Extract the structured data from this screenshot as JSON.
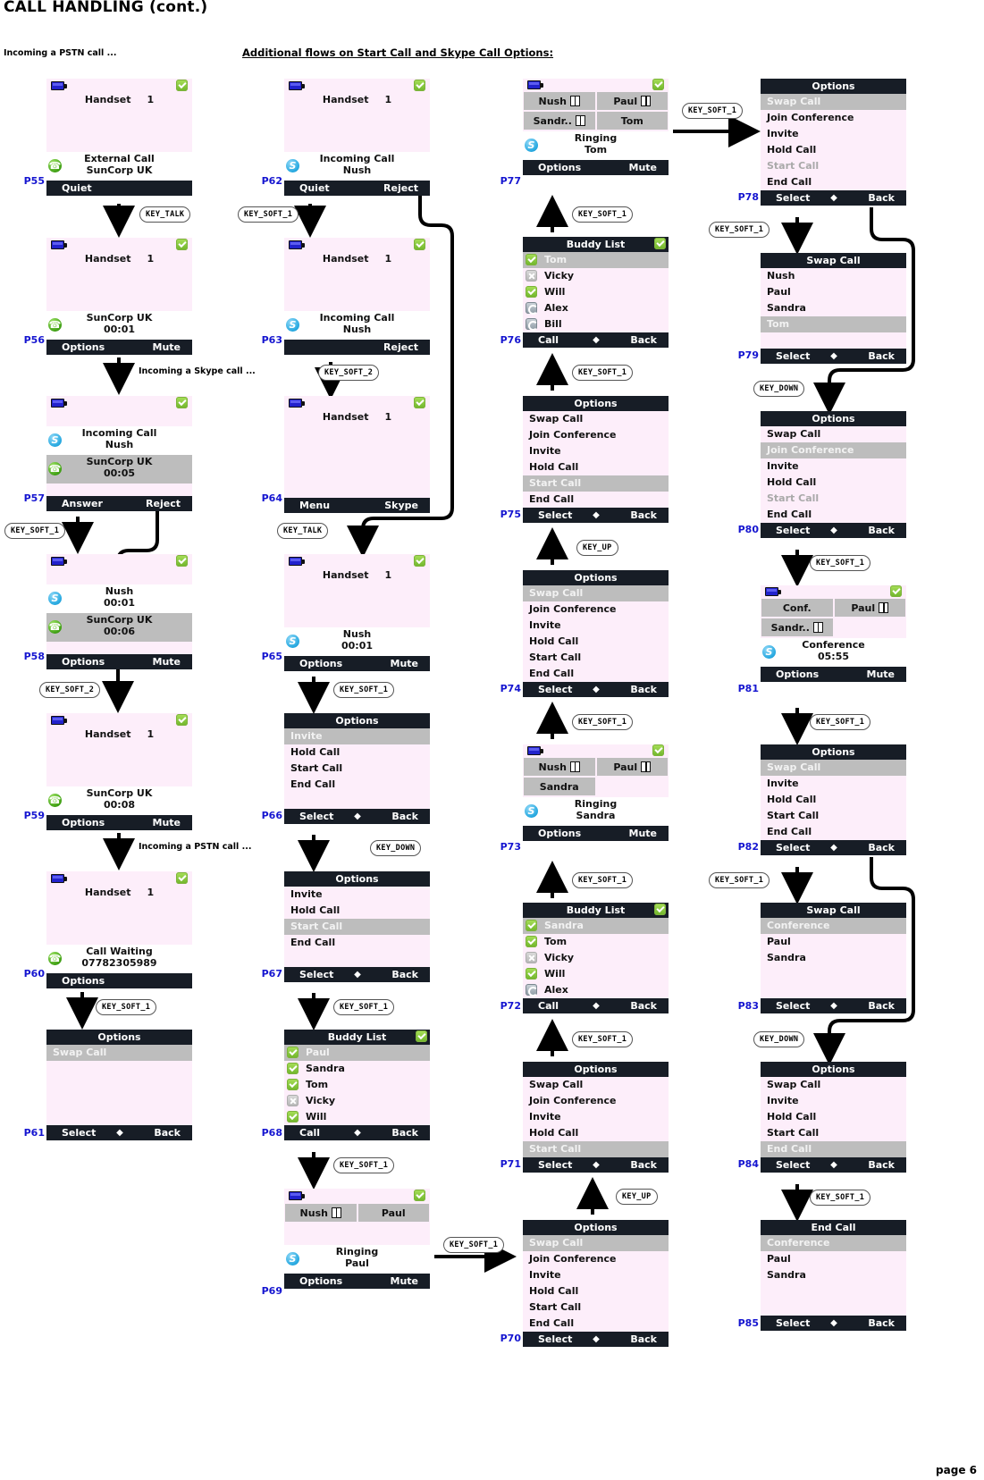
{
  "title": "CALL HANDLING (cont.)",
  "page_label": "page 6",
  "captions": {
    "pstn": "Incoming a PSTN call ...",
    "additional": "Additional flows on Start Call and Skype Call Options:",
    "skype_inline": "Incoming a Skype call ...",
    "pstn_inline": "Incoming a PSTN call ..."
  },
  "keys": {
    "talk": "KEY_TALK",
    "soft1": "KEY_SOFT_1",
    "soft2": "KEY_SOFT_2",
    "up": "KEY_UP",
    "down": "KEY_DOWN"
  },
  "screens": {
    "P55": {
      "id": "P55",
      "handset": "Handset",
      "handset_num": "1",
      "info_l1": "External Call",
      "info_l2": "SunCorp UK",
      "info_icon": "pstn-icon",
      "sk_left": "Quiet",
      "sk_right": ""
    },
    "P56": {
      "id": "P56",
      "handset": "Handset",
      "handset_num": "1",
      "info_l1": "SunCorp UK",
      "info_l2": "00:01",
      "info_icon": "pstn-icon",
      "sk_left": "Options",
      "sk_right": "Mute"
    },
    "P57": {
      "id": "P57",
      "info_l1": "Incoming Call",
      "info_l2": "Nush",
      "info_icon": "skype-icon",
      "held_l1": "SunCorp UK",
      "held_l2": "00:05",
      "held_icon": "pstn-icon",
      "sk_left": "Answer",
      "sk_right": "Reject"
    },
    "P58": {
      "id": "P58",
      "info_l1": "Nush",
      "info_l2": "00:01",
      "info_icon": "skype-icon",
      "held_l1": "SunCorp UK",
      "held_l2": "00:06",
      "held_icon": "pstn-icon",
      "sk_left": "Options",
      "sk_right": "Mute"
    },
    "P59": {
      "id": "P59",
      "handset": "Handset",
      "handset_num": "1",
      "info_l1": "SunCorp UK",
      "info_l2": "00:08",
      "info_icon": "pstn-icon",
      "sk_left": "Options",
      "sk_right": "Mute"
    },
    "P60": {
      "id": "P60",
      "handset": "Handset",
      "handset_num": "1",
      "info_l1": "Call Waiting",
      "info_l2": "07782305989",
      "info_icon": "pstn-icon",
      "sk_left": "Options",
      "sk_right": ""
    },
    "P61": {
      "id": "P61",
      "title": "Options",
      "items": [
        {
          "label": "Swap Call",
          "state": "selected"
        }
      ],
      "sk_left": "Select",
      "sk_right": "Back"
    },
    "P62": {
      "id": "P62",
      "handset": "Handset",
      "handset_num": "1",
      "info_l1": "Incoming Call",
      "info_l2": "Nush",
      "info_icon": "skype-icon",
      "sk_left": "Quiet",
      "sk_right": "Reject"
    },
    "P63": {
      "id": "P63",
      "handset": "Handset",
      "handset_num": "1",
      "info_l1": "Incoming Call",
      "info_l2": "Nush",
      "info_icon": "skype-icon",
      "sk_left": "",
      "sk_right": "Reject"
    },
    "P64": {
      "id": "P64",
      "handset": "Handset",
      "handset_num": "1",
      "sk_left": "Menu",
      "sk_right": "Skype"
    },
    "P65": {
      "id": "P65",
      "handset": "Handset",
      "handset_num": "1",
      "info_l1": "Nush",
      "info_l2": "00:01",
      "info_icon": "skype-icon",
      "sk_left": "Options",
      "sk_right": "Mute"
    },
    "P66": {
      "id": "P66",
      "title": "Options",
      "items": [
        {
          "label": "Invite",
          "state": "selected"
        },
        {
          "label": "Hold Call",
          "state": "normal"
        },
        {
          "label": "Start Call",
          "state": "normal"
        },
        {
          "label": "End Call",
          "state": "normal"
        }
      ],
      "sk_left": "Select",
      "sk_right": "Back"
    },
    "P67": {
      "id": "P67",
      "title": "Options",
      "items": [
        {
          "label": "Invite",
          "state": "normal"
        },
        {
          "label": "Hold Call",
          "state": "normal"
        },
        {
          "label": "Start Call",
          "state": "selected"
        },
        {
          "label": "End Call",
          "state": "normal"
        }
      ],
      "sk_left": "Select",
      "sk_right": "Back"
    },
    "P68": {
      "id": "P68",
      "title": "Buddy List",
      "title_badge": "ok-badge",
      "buddies": [
        {
          "name": "Paul",
          "status": "online",
          "state": "selected"
        },
        {
          "name": "Sandra",
          "status": "online",
          "state": "normal"
        },
        {
          "name": "Tom",
          "status": "online",
          "state": "normal"
        },
        {
          "name": "Vicky",
          "status": "offline",
          "state": "normal"
        },
        {
          "name": "Will",
          "status": "online",
          "state": "normal"
        }
      ],
      "sk_left": "Call",
      "sk_right": "Back"
    },
    "P69": {
      "id": "P69",
      "lines": [
        [
          "Nush",
          "Paul"
        ]
      ],
      "lines_hold": [
        [
          true,
          false
        ]
      ],
      "info_l1": "Ringing",
      "info_l2": "Paul",
      "info_icon": "skype-icon",
      "sk_left": "Options",
      "sk_right": "Mute"
    },
    "P70": {
      "id": "P70",
      "title": "Options",
      "items": [
        {
          "label": "Swap Call",
          "state": "selected"
        },
        {
          "label": "Join Conference",
          "state": "normal"
        },
        {
          "label": "Invite",
          "state": "normal"
        },
        {
          "label": "Hold Call",
          "state": "normal"
        },
        {
          "label": "Start Call",
          "state": "normal"
        },
        {
          "label": "End Call",
          "state": "normal"
        }
      ],
      "sk_left": "Select",
      "sk_right": "Back"
    },
    "P71": {
      "id": "P71",
      "title": "Options",
      "items": [
        {
          "label": "Swap Call",
          "state": "normal"
        },
        {
          "label": "Join Conference",
          "state": "normal"
        },
        {
          "label": "Invite",
          "state": "normal"
        },
        {
          "label": "Hold Call",
          "state": "normal"
        },
        {
          "label": "Start Call",
          "state": "selected"
        }
      ],
      "sk_left": "Select",
      "sk_right": "Back"
    },
    "P72": {
      "id": "P72",
      "title": "Buddy List",
      "title_badge": "ok-badge",
      "buddies": [
        {
          "name": "Sandra",
          "status": "online",
          "state": "selected"
        },
        {
          "name": "Tom",
          "status": "online",
          "state": "normal"
        },
        {
          "name": "Vicky",
          "status": "offline",
          "state": "normal"
        },
        {
          "name": "Will",
          "status": "online",
          "state": "normal"
        },
        {
          "name": "Alex",
          "status": "away",
          "state": "normal"
        }
      ],
      "sk_left": "Call",
      "sk_right": "Back"
    },
    "P73": {
      "id": "P73",
      "lines": [
        [
          "Nush",
          "Paul"
        ],
        [
          "Sandra",
          ""
        ]
      ],
      "lines_hold": [
        [
          true,
          true
        ],
        [
          false,
          false
        ]
      ],
      "info_l1": "Ringing",
      "info_l2": "Sandra",
      "info_icon": "skype-icon",
      "sk_left": "Options",
      "sk_right": "Mute"
    },
    "P74": {
      "id": "P74",
      "title": "Options",
      "items": [
        {
          "label": "Swap Call",
          "state": "selected"
        },
        {
          "label": "Join Conference",
          "state": "normal"
        },
        {
          "label": "Invite",
          "state": "normal"
        },
        {
          "label": "Hold Call",
          "state": "normal"
        },
        {
          "label": "Start Call",
          "state": "normal"
        },
        {
          "label": "End Call",
          "state": "normal"
        }
      ],
      "sk_left": "Select",
      "sk_right": "Back"
    },
    "P75": {
      "id": "P75",
      "title": "Options",
      "items": [
        {
          "label": "Swap Call",
          "state": "normal"
        },
        {
          "label": "Join Conference",
          "state": "normal"
        },
        {
          "label": "Invite",
          "state": "normal"
        },
        {
          "label": "Hold Call",
          "state": "normal"
        },
        {
          "label": "Start Call",
          "state": "selected"
        },
        {
          "label": "End Call",
          "state": "normal"
        }
      ],
      "sk_left": "Select",
      "sk_right": "Back"
    },
    "P76": {
      "id": "P76",
      "title": "Buddy List",
      "title_badge": "ok-badge",
      "buddies": [
        {
          "name": "Tom",
          "status": "online",
          "state": "selected"
        },
        {
          "name": "Vicky",
          "status": "offline",
          "state": "normal"
        },
        {
          "name": "Will",
          "status": "online",
          "state": "normal"
        },
        {
          "name": "Alex",
          "status": "away",
          "state": "normal"
        },
        {
          "name": "Bill",
          "status": "away",
          "state": "normal"
        }
      ],
      "sk_left": "Call",
      "sk_right": "Back"
    },
    "P77": {
      "id": "P77",
      "lines": [
        [
          "Nush",
          "Paul"
        ],
        [
          "Sandr..",
          "Tom"
        ]
      ],
      "lines_hold": [
        [
          true,
          true
        ],
        [
          true,
          false
        ]
      ],
      "info_l1": "Ringing",
      "info_l2": "Tom",
      "info_icon": "skype-icon",
      "sk_left": "Options",
      "sk_right": "Mute"
    },
    "P78": {
      "id": "P78",
      "title": "Options",
      "items": [
        {
          "label": "Swap Call",
          "state": "selected"
        },
        {
          "label": "Join Conference",
          "state": "normal"
        },
        {
          "label": "Invite",
          "state": "normal"
        },
        {
          "label": "Hold Call",
          "state": "normal"
        },
        {
          "label": "Start Call",
          "state": "disabled"
        },
        {
          "label": "End Call",
          "state": "normal"
        }
      ],
      "sk_left": "Select",
      "sk_right": "Back"
    },
    "P79": {
      "id": "P79",
      "title": "Swap Call",
      "items": [
        {
          "label": "Nush",
          "state": "normal"
        },
        {
          "label": "Paul",
          "state": "normal"
        },
        {
          "label": "Sandra",
          "state": "normal"
        },
        {
          "label": "Tom",
          "state": "selected"
        }
      ],
      "sk_left": "Select",
      "sk_right": "Back"
    },
    "P80": {
      "id": "P80",
      "title": "Options",
      "items": [
        {
          "label": "Swap Call",
          "state": "normal"
        },
        {
          "label": "Join Conference",
          "state": "selected"
        },
        {
          "label": "Invite",
          "state": "normal"
        },
        {
          "label": "Hold Call",
          "state": "normal"
        },
        {
          "label": "Start Call",
          "state": "disabled"
        },
        {
          "label": "End Call",
          "state": "normal"
        }
      ],
      "sk_left": "Select",
      "sk_right": "Back"
    },
    "P81": {
      "id": "P81",
      "lines": [
        [
          "Conf.",
          "Paul"
        ],
        [
          "Sandr..",
          ""
        ]
      ],
      "lines_hold": [
        [
          false,
          true
        ],
        [
          true,
          false
        ]
      ],
      "info_l1": "Conference",
      "info_l2": "05:55",
      "info_icon": "skype-icon",
      "sk_left": "Options",
      "sk_right": "Mute"
    },
    "P82": {
      "id": "P82",
      "title": "Options",
      "items": [
        {
          "label": "Swap Call",
          "state": "selected"
        },
        {
          "label": "Invite",
          "state": "normal"
        },
        {
          "label": "Hold Call",
          "state": "normal"
        },
        {
          "label": "Start Call",
          "state": "normal"
        },
        {
          "label": "End Call",
          "state": "normal"
        }
      ],
      "sk_left": "Select",
      "sk_right": "Back"
    },
    "P83": {
      "id": "P83",
      "title": "Swap Call",
      "items": [
        {
          "label": "Conference",
          "state": "selected"
        },
        {
          "label": "Paul",
          "state": "normal"
        },
        {
          "label": "Sandra",
          "state": "normal"
        }
      ],
      "sk_left": "Select",
      "sk_right": "Back"
    },
    "P84": {
      "id": "P84",
      "title": "Options",
      "items": [
        {
          "label": "Swap Call",
          "state": "normal"
        },
        {
          "label": "Invite",
          "state": "normal"
        },
        {
          "label": "Hold Call",
          "state": "normal"
        },
        {
          "label": "Start Call",
          "state": "normal"
        },
        {
          "label": "End Call",
          "state": "selected"
        }
      ],
      "sk_left": "Select",
      "sk_right": "Back"
    },
    "P85": {
      "id": "P85",
      "title": "End Call",
      "items": [
        {
          "label": "Conference",
          "state": "selected"
        },
        {
          "label": "Paul",
          "state": "normal"
        },
        {
          "label": "Sandra",
          "state": "normal"
        }
      ],
      "sk_left": "Select",
      "sk_right": "Back"
    }
  },
  "colors": {
    "screen_bg": "#fdeefa",
    "bar_bg": "#171d26",
    "selected_bg": "#bdbdbd",
    "label_blue": "#1515d0"
  }
}
